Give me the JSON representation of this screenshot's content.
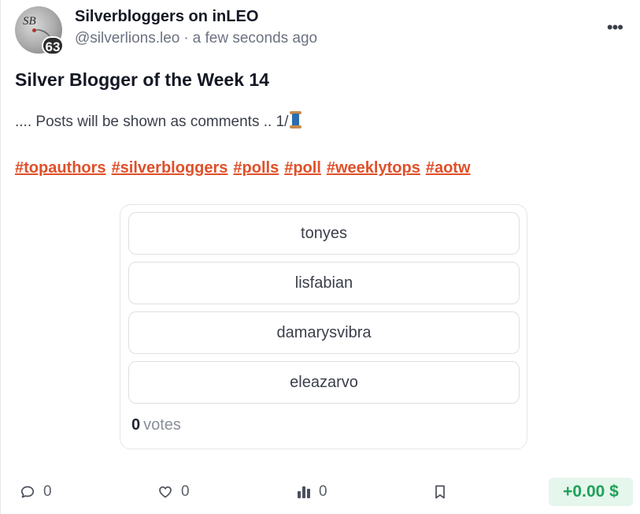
{
  "post": {
    "author_name": "Silverbloggers on inLEO",
    "handle": "@silverlions.leo",
    "separator": "·",
    "timestamp": "a few seconds ago",
    "avatar_badge": "63",
    "avatar_monogram": "SB",
    "more_label": "•••",
    "title": "Silver Blogger of the Week 14",
    "body": ".... Posts will be shown as comments .. 1/",
    "body_emoji_icon": "spool-of-thread-icon",
    "tags": [
      "#topauthors",
      "#silverbloggers",
      "#polls",
      "#poll",
      "#weeklytops",
      "#aotw"
    ]
  },
  "poll": {
    "options": [
      "tonyes",
      "lisfabian",
      "damarysvibra",
      "eleazarvo"
    ],
    "vote_count": "0",
    "vote_label": "votes"
  },
  "actions": {
    "comments": {
      "icon": "comment-icon",
      "count": "0"
    },
    "likes": {
      "icon": "heart-icon",
      "count": "0"
    },
    "stats": {
      "icon": "bar-chart-icon",
      "count": "0"
    },
    "bookmark": {
      "icon": "bookmark-icon"
    },
    "payout": "+0.00 $"
  },
  "colors": {
    "tag": "#e0502a",
    "payout_text": "#1fa05a",
    "payout_bg": "#e5f6ec"
  }
}
